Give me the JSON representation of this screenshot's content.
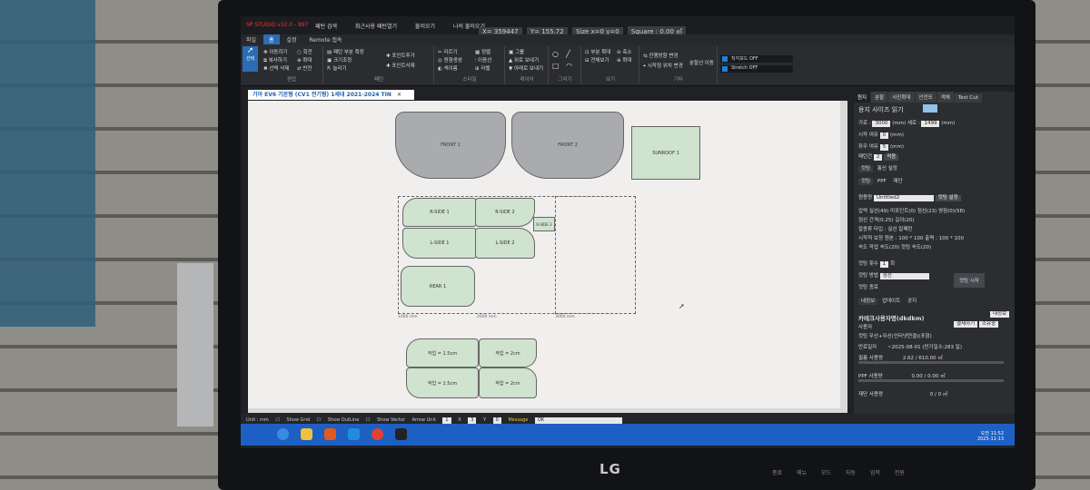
{
  "app": {
    "title": "SP STUDIO v32.0 - 897",
    "menu": [
      "패턴 검색",
      "최근사용 패턴열기",
      "불러오기",
      "나의 불러오기"
    ],
    "coords": {
      "x": "X= 359447",
      "y": "Y= 155.72",
      "size": "Size x=0 y=0",
      "square": "Square : 0.00 ㎡"
    }
  },
  "ribbon": {
    "tabs": [
      "파일",
      "홈",
      "설정",
      "Remote 접속"
    ],
    "active_tab": "홈",
    "groups": [
      {
        "caption": "편집",
        "items": [
          "이동하기",
          "복사하기",
          "선택 삭제",
          "회전",
          "확대",
          "반전"
        ]
      },
      {
        "caption": "패턴",
        "items": [
          "패턴 부분 확장",
          "크기조정",
          "늘리기",
          "포인트추가",
          "포인트삭제"
        ]
      },
      {
        "caption": "스타일",
        "items": [
          "자르기",
          "원형생성",
          "색이름",
          "정렬",
          "이음선",
          "라벨"
        ]
      },
      {
        "caption": "레이어",
        "items": [
          "그룹",
          "위로 보내기",
          "아래로 보내기"
        ]
      },
      {
        "caption": "그리기",
        "items": []
      },
      {
        "caption": "보기",
        "items": [
          "부분 확대",
          "전체보기",
          "축소",
          "확대"
        ]
      },
      {
        "caption": "기타",
        "items": [
          "진행방향 변경",
          "시작점 위치 변경",
          "분할선 이동"
        ]
      }
    ],
    "toggles": [
      "직각모드 OFF",
      "Stretch OFF"
    ],
    "select_tool": "선택"
  },
  "document": {
    "tab_label": "기아 EV6 기본형 (CV1 전기형) 1세대 2021-2024 TIN"
  },
  "pieces": {
    "front1": "FRONT 1",
    "front2": "FRONT 2",
    "sunroof": "SUNROOF 1",
    "rside1": "R-SIDE 1",
    "rside2": "R-SIDE 2",
    "rside3": "R-SIDE 3",
    "lside1": "L-SIDE 1",
    "lside2": "L-SIDE 2",
    "rear": "REAR 1",
    "mid1": "작업 = 1.5cm",
    "mid2": "작업 = 2cm",
    "mid3": "작업 = 1.5cm",
    "mid4": "작업 = 2cm"
  },
  "dims": [
    "1000 mm",
    "2000 mm",
    "3000 mm"
  ],
  "right_panel": {
    "tabs": [
      "원지",
      "분할",
      "사진확대",
      "안전모",
      "객체",
      "Test Cut"
    ],
    "size_title": "용지 사이즈 읽기",
    "width_label": "가로 :",
    "width_value": "3000",
    "height_label": "세로 :",
    "height_value": "1499",
    "unit": "(mm)",
    "start_pos_label": "시작 여유",
    "start_pos_value": "0",
    "margin_label": "좌우 여유",
    "margin_value": "5",
    "interval_label": "패턴간",
    "interval_value": "2",
    "apply": "적용",
    "cut_tabs": [
      "컷팅",
      "통신 설정"
    ],
    "mode_tabs": [
      "컷팅",
      "PPF",
      "재단"
    ],
    "template_label": "원용량",
    "template_value": "Untitled2",
    "template_button": "컷팅 설정",
    "info": [
      {
        "k": "압력",
        "v": "실선(49) 미포인트(0) 점선(23) 영점(0)(58)"
      },
      {
        "k": "점선",
        "v": "간격(0.25) 길이(20)"
      },
      {
        "k": "칼종류",
        "v": "타입 : 실선 칼패턴"
      },
      {
        "k": "시작적 보정",
        "v": "원본 : 100 * 100 출력 : 100 * 100"
      },
      {
        "k": "속도",
        "v": "작업 속도(20) 컷팅 속도(20)"
      }
    ],
    "cut_count_label": "컷팅 횟수",
    "cut_count_value": "1",
    "cut_count_unit": "회",
    "cut_method_label": "컷팅 방법",
    "cut_method_value": "점선",
    "cut_start": "컷팅 시작",
    "cut_order_label": "컷팅 종료",
    "account_tabs": [
      "내정보",
      "업데이트",
      "공지"
    ],
    "company": "카테크사용자명(dkdkm)",
    "company_btn1": "내정보",
    "grade_label": "사용자",
    "grade_btn1": "결제하기",
    "grade_btn2": "소유중",
    "service_line": "컷팅 무선+무선(인터넷연결)(포함)",
    "usage_rows": [
      {
        "k": "만료일자",
        "v": "~2025-08-01 (만기일수:283 일)"
      },
      {
        "k": "필름 사용량",
        "v": "2.62 / 610.00 ㎡"
      },
      {
        "k": "PPF 사용량",
        "v": "0.00 / 0.00 ㎡"
      },
      {
        "k": "재단 사용량",
        "v": "0 / 0 ㎡"
      }
    ]
  },
  "statusbar": {
    "unit": "Unit : mm",
    "show_grid": "Show Grid",
    "show_outline": "Show OutLine",
    "show_vector": "Show Vector",
    "arrow_unit": "Arrow Unit",
    "arrow_value": "1",
    "x_label": "X",
    "x_value": "3",
    "y_label": "Y",
    "y_value": "0",
    "message_label": "Message",
    "message_value": "OK"
  },
  "taskbar": {
    "time": "오전 11:52",
    "date": "2025-11-13"
  },
  "monitor": {
    "brand": "LG",
    "buttons": [
      "종료",
      "메뉴",
      "모드",
      "자동",
      "입력",
      "전원"
    ]
  }
}
